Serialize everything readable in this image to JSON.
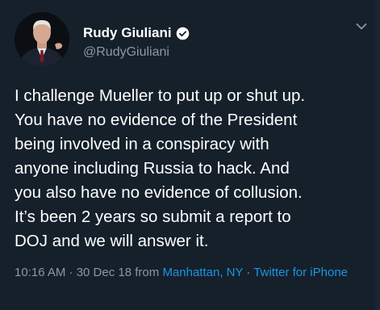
{
  "tweet": {
    "author": {
      "name": "Rudy Giuliani",
      "handle": "@RudyGiuliani",
      "verified": true,
      "avatar_icon": "profile-photo"
    },
    "text": "I challenge Mueller to put up or shut up.\nYou have no evidence of the President\nbeing involved in a conspiracy with\nanyone including Russia to hack.  And\nyou also have no evidence of collusion.\nIt’s been 2 years so submit a report to\nDOJ and we will answer it.",
    "timestamp": "10:16 AM · 30 Dec 18",
    "from_label": " from ",
    "location": "Manhattan, NY",
    "separator": " · ",
    "source": "Twitter for iPhone"
  },
  "icons": {
    "verified": "verified-badge-icon",
    "more": "chevron-down-icon"
  },
  "colors": {
    "background": "#15202b",
    "text": "#ffffff",
    "secondary": "#8899a6",
    "accent": "#1b95e0"
  }
}
